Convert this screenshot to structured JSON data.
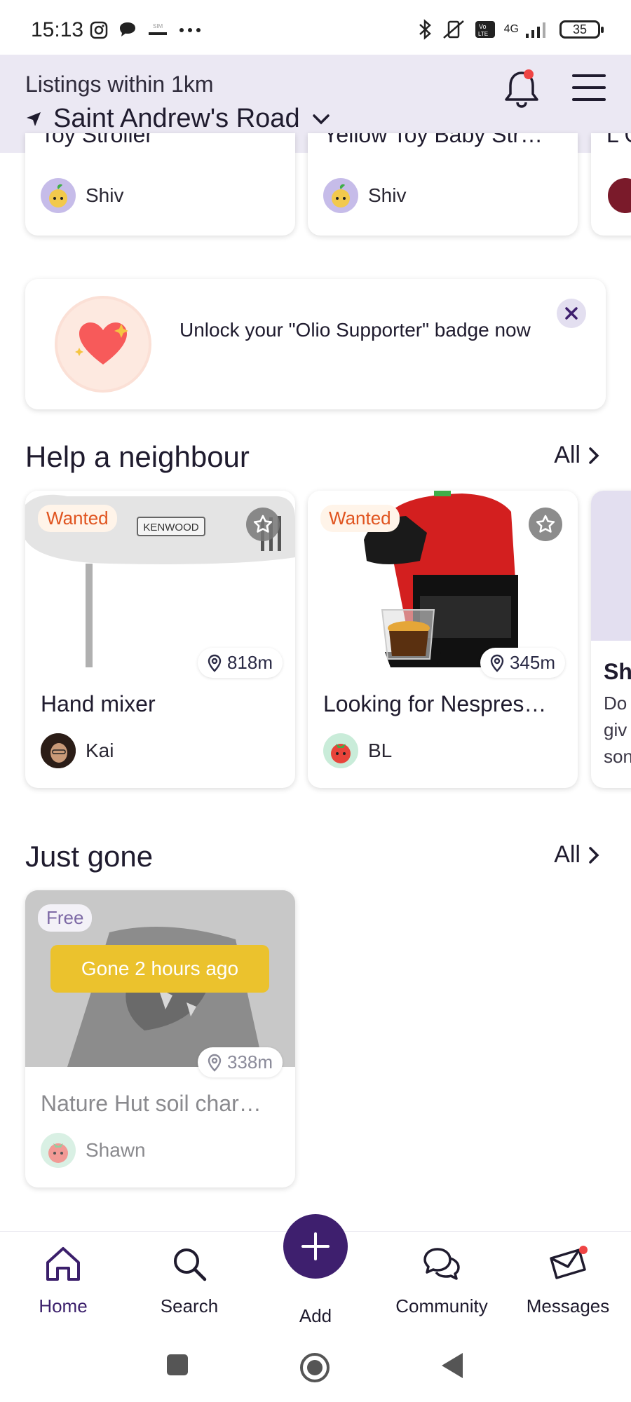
{
  "status_bar": {
    "time": "15:13",
    "network": "4G",
    "battery": "35"
  },
  "header": {
    "subtitle": "Listings within 1km",
    "location": "Saint Andrew's Road"
  },
  "top_row": {
    "items": [
      {
        "title": "Toy Stroller",
        "owner": "Shiv"
      },
      {
        "title": "Yellow Toy Baby Str…",
        "owner": "Shiv"
      },
      {
        "title": "L G",
        "owner": ""
      }
    ]
  },
  "banner": {
    "text": "Unlock your \"Olio Supporter\" badge now"
  },
  "help_section": {
    "title": "Help a neighbour",
    "all_label": "All",
    "items": [
      {
        "badge": "Wanted",
        "brand": "KENWOOD",
        "distance": "818m",
        "title": "Hand mixer",
        "owner": "Kai"
      },
      {
        "badge": "Wanted",
        "distance": "345m",
        "title": "Looking for Nespres…",
        "owner": "BL"
      },
      {
        "title": "Sh",
        "desc": "Do giv son"
      }
    ]
  },
  "gone_section": {
    "title": "Just gone",
    "all_label": "All",
    "items": [
      {
        "badge": "Free",
        "status": "Gone 2 hours ago",
        "distance": "338m",
        "title": "Nature Hut soil char…",
        "owner": "Shawn"
      }
    ]
  },
  "bottom_nav": {
    "home": "Home",
    "search": "Search",
    "add": "Add",
    "community": "Community",
    "messages": "Messages"
  },
  "colors": {
    "header_bg": "#ebe8f3",
    "brand_purple": "#3e1f6e",
    "wanted_orange": "#e0541f",
    "gone_yellow": "#ebc22d",
    "notification_red": "#ef4444"
  }
}
